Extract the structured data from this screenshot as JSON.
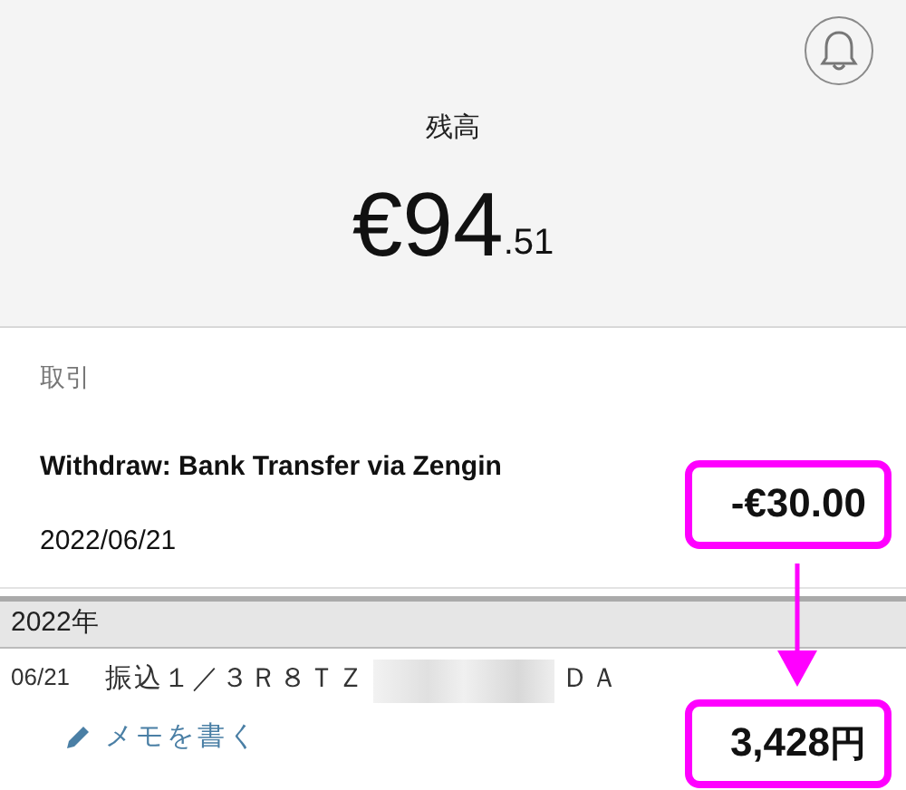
{
  "balance": {
    "label": "残高",
    "whole": "€94",
    "fraction": ".51"
  },
  "section_label": "取引",
  "transaction": {
    "title": "Withdraw: Bank Transfer via Zengin",
    "date": "2022/06/21",
    "amount": "-€30.00",
    "highlighted": true
  },
  "bank_statement": {
    "year": "2022年",
    "date": "06/21",
    "description_start": "振込１／３Ｒ８ＴＺ",
    "redacted": true,
    "description_end": "ＤＡ",
    "memo_link": "メモを書く",
    "amount": "3,428",
    "currency": "円",
    "highlighted": true
  },
  "connector_arrow": true
}
